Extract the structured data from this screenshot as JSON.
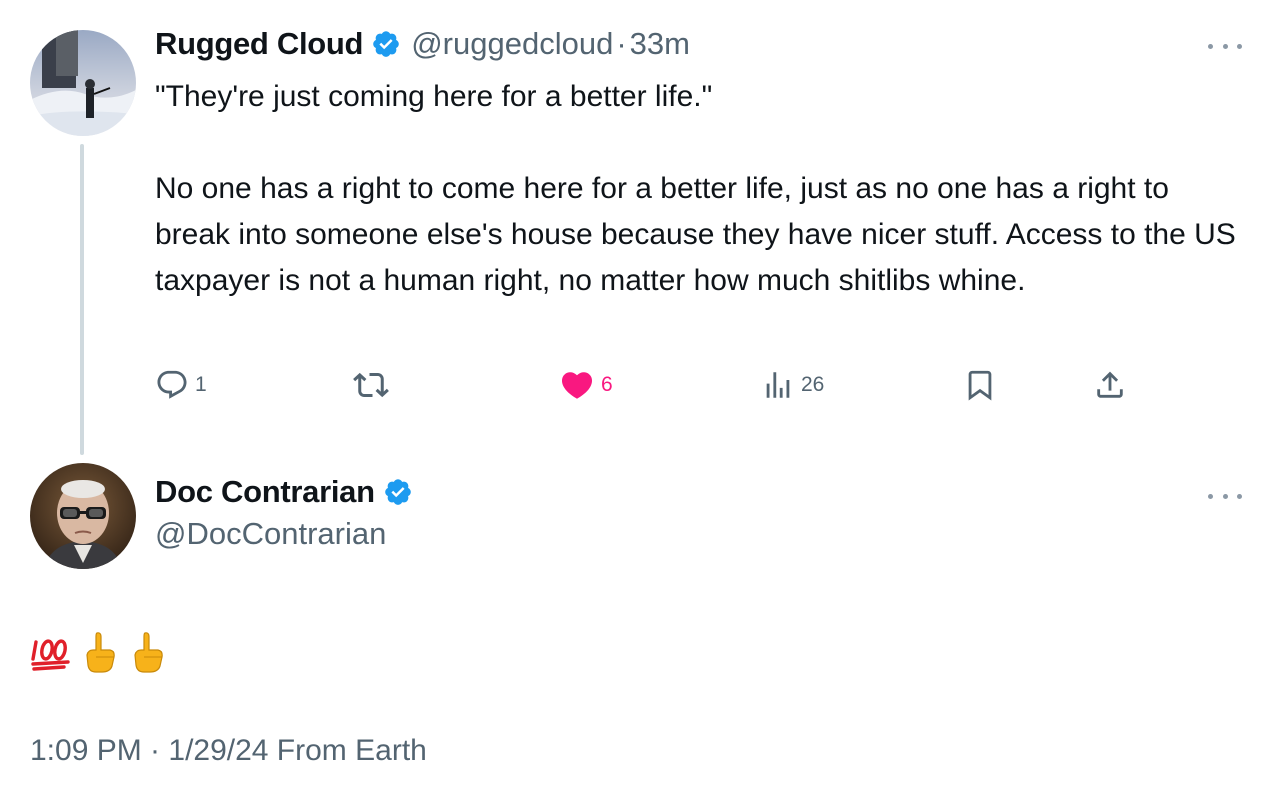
{
  "parent_tweet": {
    "author_name": "Rugged Cloud",
    "handle": "@ruggedcloud",
    "separator": "·",
    "age": "33m",
    "paragraphs": [
      "\"They're just coming here for a better life.\"",
      "No one has a right to come here for a better life, just as no one has a right to break into someone else's house because they have nicer stuff. Access to the US taxpayer is not a human right, no matter how much shitlibs whine."
    ],
    "actions": {
      "reply_count": "1",
      "retweet_count": "",
      "like_count": "6",
      "views_count": "26"
    },
    "verified": true
  },
  "reply_tweet": {
    "author_name": "Doc Contrarian",
    "handle": "@DocContrarian",
    "verified": true,
    "text": "💯👆👆",
    "footer": "1:09 PM · 1/29/24 From Earth"
  },
  "icons": {
    "more": "more-dots-icon",
    "verified": "verified-badge-icon",
    "reply": "reply-icon",
    "retweet": "retweet-icon",
    "like": "heart-icon",
    "views": "views-chart-icon",
    "bookmark": "bookmark-icon",
    "share": "share-icon"
  },
  "colors": {
    "verified_blue": "#1d9bf0",
    "like_pink": "#f91880",
    "muted_text": "#536471",
    "text": "#0f1419",
    "thread_line": "#cfd9de"
  }
}
